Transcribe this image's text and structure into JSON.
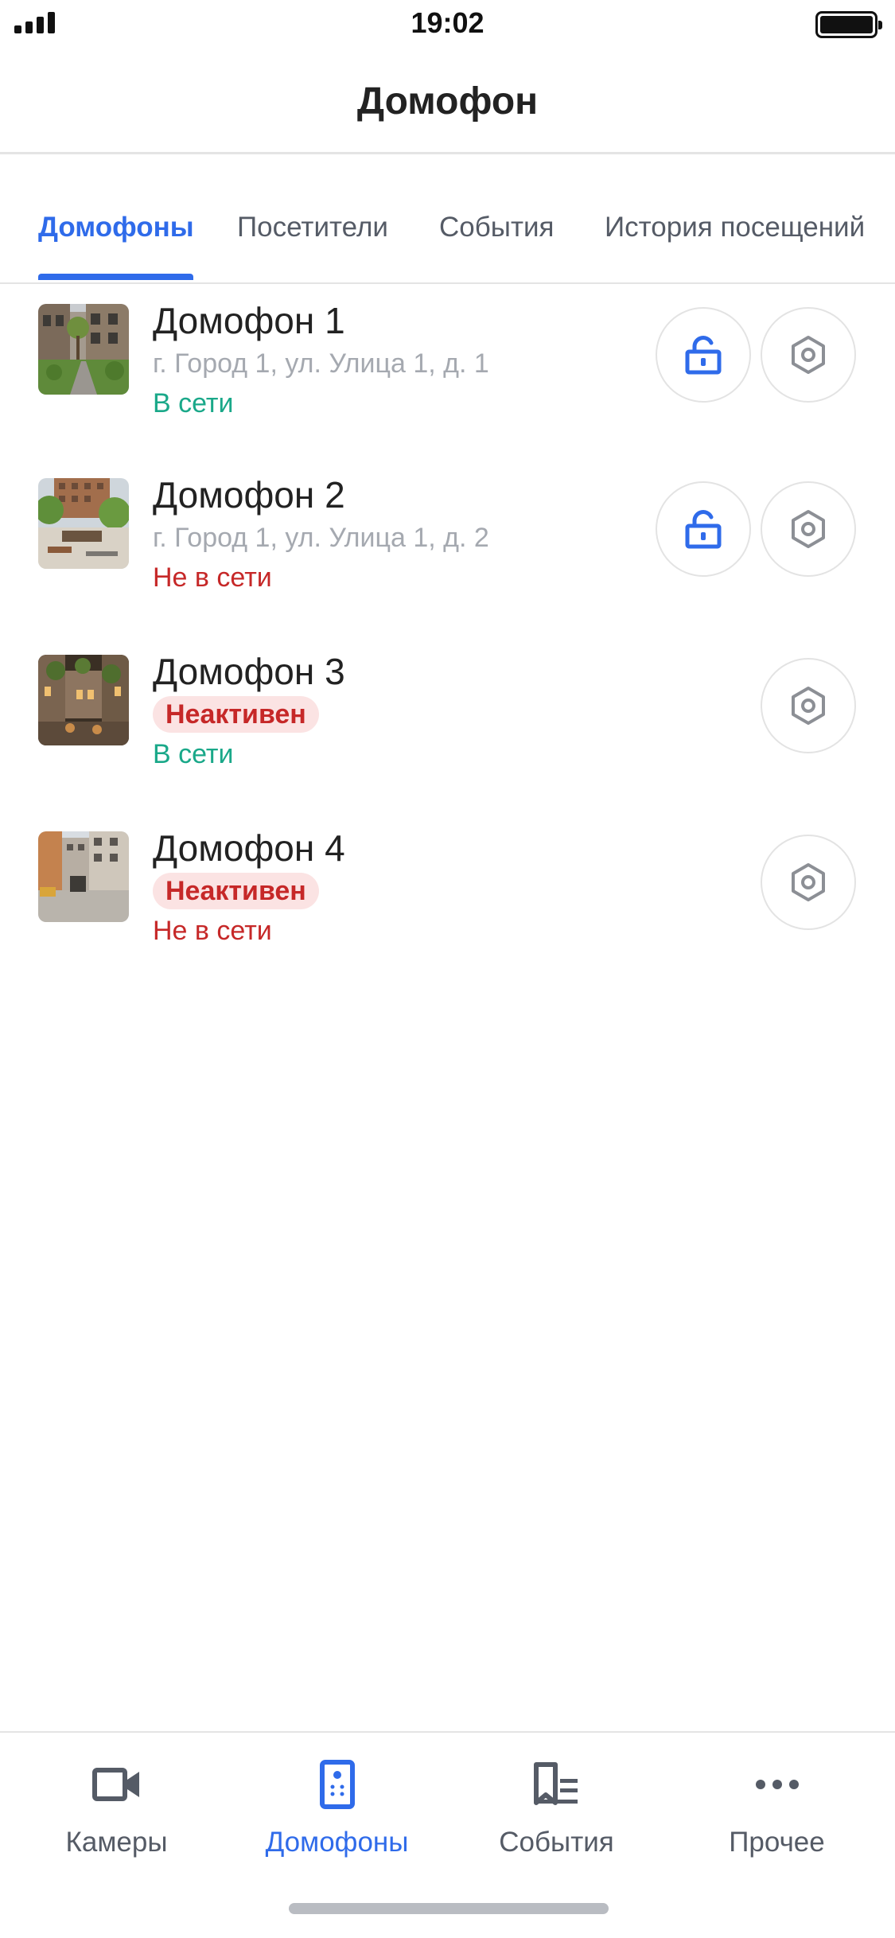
{
  "status_bar": {
    "time": "19:02"
  },
  "header": {
    "title": "Домофон"
  },
  "tabs": [
    {
      "label": "Домофоны",
      "active": true
    },
    {
      "label": "Посетители",
      "active": false
    },
    {
      "label": "События",
      "active": false
    },
    {
      "label": "История посещений",
      "active": false
    }
  ],
  "intercoms": [
    {
      "name": "Домофон 1",
      "address": "г. Город 1, ул. Улица 1, д. 1",
      "badge": "",
      "status": "В сети",
      "online": true,
      "has_unlock": true
    },
    {
      "name": "Домофон 2",
      "address": "г. Город 1, ул. Улица 1, д. 2",
      "badge": "",
      "status": "Не в сети",
      "online": false,
      "has_unlock": true
    },
    {
      "name": "Домофон 3",
      "address": "",
      "badge": "Неактивен",
      "status": "В сети",
      "online": true,
      "has_unlock": false
    },
    {
      "name": "Домофон 4",
      "address": "",
      "badge": "Неактивен",
      "status": "Не в сети",
      "online": false,
      "has_unlock": false
    }
  ],
  "bottom_nav": [
    {
      "label": "Камеры",
      "icon": "camera-icon",
      "active": false
    },
    {
      "label": "Домофоны",
      "icon": "intercom-icon",
      "active": true
    },
    {
      "label": "События",
      "icon": "events-icon",
      "active": false
    },
    {
      "label": "Прочее",
      "icon": "more-icon",
      "active": false
    }
  ],
  "colors": {
    "accent": "#2f6bea",
    "online": "#1aa889",
    "offline": "#c62828",
    "badge_bg": "#fbe3e3"
  }
}
